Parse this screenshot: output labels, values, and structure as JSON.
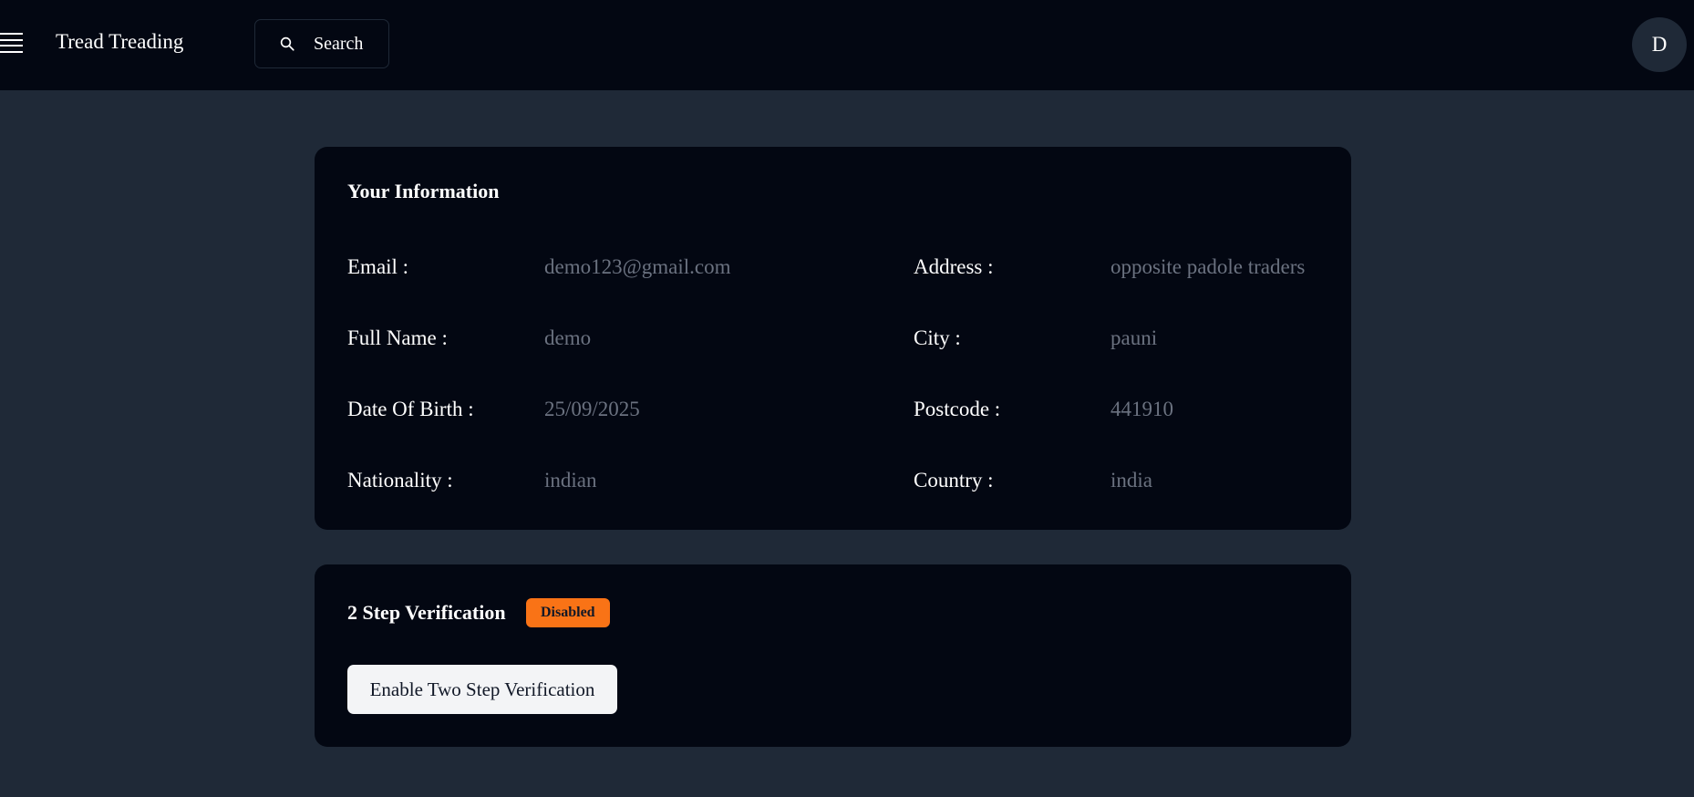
{
  "header": {
    "brand": "Tread Treading",
    "search_label": "Search",
    "avatar_initial": "D"
  },
  "info": {
    "title": "Your Information",
    "fields": [
      {
        "label": "Email :",
        "value": "demo123@gmail.com"
      },
      {
        "label": "Full Name :",
        "value": "demo"
      },
      {
        "label": "Date Of Birth :",
        "value": "25/09/2025"
      },
      {
        "label": "Nationality :",
        "value": "indian"
      },
      {
        "label": "Address :",
        "value": "opposite padole traders"
      },
      {
        "label": "City :",
        "value": "pauni"
      },
      {
        "label": "Postcode :",
        "value": "441910"
      },
      {
        "label": "Country :",
        "value": "india"
      }
    ]
  },
  "twofa": {
    "title": "2 Step Verification",
    "status": "Disabled",
    "status_color": "#f97316",
    "button_label": "Enable Two Step Verification"
  },
  "icons": [
    "menu-icon",
    "search-icon"
  ]
}
